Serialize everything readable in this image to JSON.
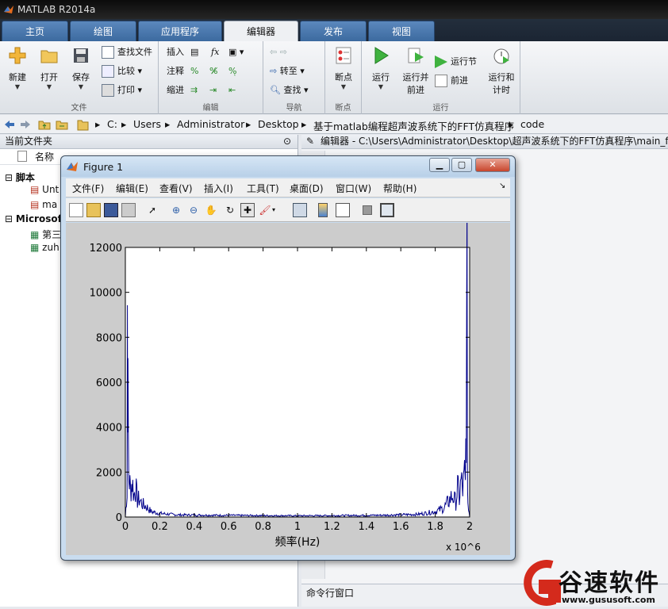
{
  "app": {
    "title": "MATLAB R2014a"
  },
  "tabs": [
    {
      "label": "主页"
    },
    {
      "label": "绘图"
    },
    {
      "label": "应用程序"
    },
    {
      "label": "编辑器"
    },
    {
      "label": "发布"
    },
    {
      "label": "视图"
    }
  ],
  "ribbon": {
    "file_group": {
      "label": "文件",
      "new": "新建",
      "open": "打开",
      "save": "保存",
      "find_files": "查找文件",
      "compare": "比较",
      "print": "打印"
    },
    "edit_group": {
      "label": "编辑",
      "insert": "插入",
      "comment": "注释",
      "indent": "缩进"
    },
    "nav_group": {
      "label": "导航",
      "goto": "转至",
      "find": "查找"
    },
    "bp_group": {
      "label": "断点",
      "breakpoints": "断点"
    },
    "run_group": {
      "label": "运行",
      "run": "运行",
      "run_advance_1": "运行并",
      "run_advance_2": "前进",
      "run_section": "运行节",
      "advance": "前进",
      "run_time_1": "运行和",
      "run_time_2": "计时"
    }
  },
  "address": {
    "crumbs": [
      "C:",
      "Users",
      "Administrator",
      "Desktop",
      "基于matlab编程超声波系统下的FFT仿真程序",
      "code"
    ]
  },
  "current_folder": {
    "title": "当前文件夹",
    "column_name": "名称",
    "group_scripts": "脚本",
    "script_1": "Unt",
    "script_2": "ma",
    "group_excel": "Microsoft",
    "excel_1": "第三",
    "excel_2": "zuh"
  },
  "editor": {
    "title": "编辑器 - C:\\Users\\Administrator\\Desktop\\超声波系统下的FFT仿真程序\\main_ff"
  },
  "command_window": {
    "title": "命令行窗口"
  },
  "figure": {
    "title": "Figure 1",
    "menus": [
      "文件(F)",
      "编辑(E)",
      "查看(V)",
      "插入(I)",
      "工具(T)",
      "桌面(D)",
      "窗口(W)",
      "帮助(H)"
    ]
  },
  "watermark": {
    "brand": "谷速软件",
    "url": "www.gususoft.com"
  },
  "colors": {
    "spectrum": "#00008b",
    "plot_bg": "#ffffff",
    "figure_bg": "#cccccc",
    "accent": "#3c6a9f"
  },
  "chart_data": {
    "type": "line",
    "title": "",
    "xlabel": "频率(Hz)",
    "x_multiplier": "x 10^6",
    "ylabel": "",
    "xlim": [
      0,
      2
    ],
    "ylim": [
      0,
      12000
    ],
    "grid": false,
    "xticks": [
      "0",
      "0.2",
      "0.4",
      "0.6",
      "0.8",
      "1",
      "1.2",
      "1.4",
      "1.6",
      "1.8",
      "2"
    ],
    "yticks": [
      "0",
      "2000",
      "4000",
      "6000",
      "8000",
      "10000",
      "12000"
    ],
    "series": [
      {
        "x": [
          0.0,
          0.01,
          0.012,
          0.015,
          0.02,
          0.03,
          0.04,
          0.05,
          0.06,
          0.07,
          0.08,
          0.1,
          0.12,
          0.15,
          0.2,
          0.3,
          0.5,
          0.8,
          1.0,
          1.2,
          1.5,
          1.7,
          1.8,
          1.85,
          1.88,
          1.9,
          1.92,
          1.93,
          1.94,
          1.95,
          1.96,
          1.97,
          1.975,
          1.98,
          1.985,
          1.988,
          1.99,
          2.0
        ],
        "y": [
          0,
          1500,
          11700,
          6200,
          2300,
          1500,
          2000,
          1200,
          1700,
          900,
          1000,
          700,
          600,
          300,
          200,
          120,
          100,
          80,
          70,
          80,
          100,
          150,
          300,
          500,
          900,
          1200,
          800,
          1700,
          1000,
          2000,
          1500,
          2300,
          1700,
          6200,
          11700,
          1500,
          900,
          0
        ]
      }
    ]
  }
}
